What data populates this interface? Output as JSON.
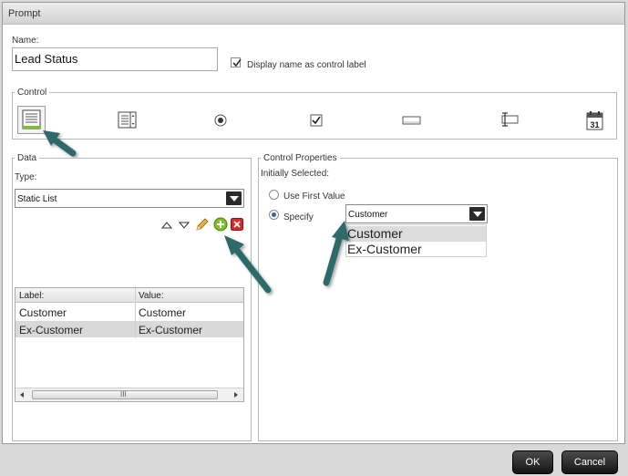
{
  "dialog": {
    "title": "Prompt"
  },
  "name_section": {
    "label": "Name:",
    "value": "Lead Status",
    "display_checkbox_label": "Display name as control label",
    "display_checked": true
  },
  "control": {
    "legend": "Control",
    "icons": [
      "list-control-icon",
      "multi-list-icon",
      "radio-button-icon",
      "checkbox-icon",
      "textbox-icon",
      "text-cursor-box-icon",
      "calendar-icon"
    ],
    "calendar_day": "31"
  },
  "data_panel": {
    "legend": "Data",
    "type_label": "Type:",
    "type_value": "Static List",
    "table": {
      "headers": [
        "Label:",
        "Value:"
      ],
      "rows": [
        [
          "Customer",
          "Customer"
        ],
        [
          "Ex-Customer",
          "Ex-Customer"
        ]
      ]
    },
    "scroll_grip": "III"
  },
  "control_properties": {
    "legend": "Control Properties",
    "initially_selected_label": "Initially Selected:",
    "use_first_value_label": "Use First Value",
    "specify_label": "Specify",
    "specify_value": "Customer",
    "options": [
      "Customer",
      "Ex-Customer"
    ]
  },
  "buttons": {
    "ok": "OK",
    "cancel": "Cancel"
  },
  "colors": {
    "accent_arrow": "#2e6a6a",
    "button_dark": "#1a1a1a",
    "highlight_green": "#7fbf2a"
  }
}
